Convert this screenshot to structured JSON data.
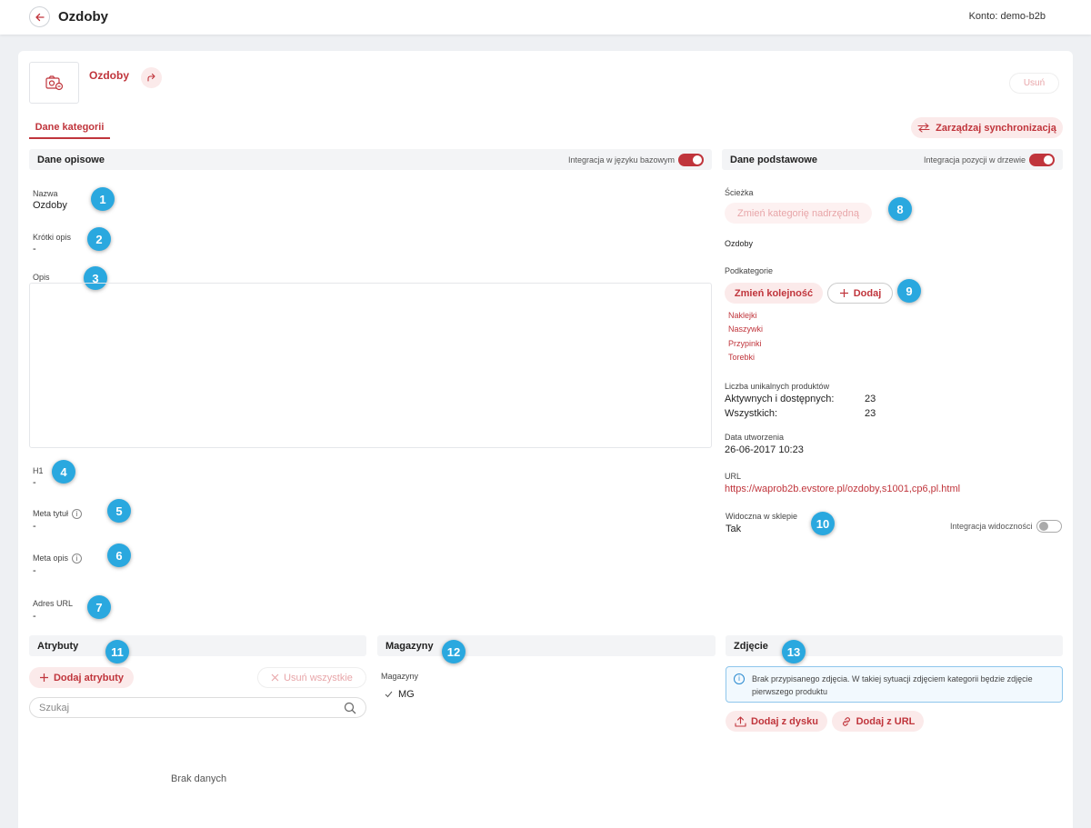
{
  "topbar": {
    "title": "Ozdoby",
    "account_label": "Konto:",
    "account_value": "demo-b2b"
  },
  "header": {
    "category_name": "Ozdoby",
    "delete_label": "Usuń",
    "tab_label": "Dane kategorii",
    "sync_label": "Zarządzaj synchronizacją"
  },
  "descriptive": {
    "title": "Dane opisowe",
    "integration_label": "Integracja w języku bazowym",
    "integration_on": true,
    "name_label": "Nazwa",
    "name_value": "Ozdoby",
    "short_label": "Krótki opis",
    "short_value": "-",
    "desc_label": "Opis",
    "h1_label": "H1",
    "h1_value": "-",
    "meta_title_label": "Meta tytuł",
    "meta_title_value": "-",
    "meta_desc_label": "Meta opis",
    "meta_desc_value": "-",
    "url_label": "Adres URL",
    "url_value": "-"
  },
  "basic": {
    "title": "Dane podstawowe",
    "integration_label": "Integracja pozycji w drzewie",
    "integration_on": true,
    "path_label": "Ścieżka",
    "change_parent": "Zmień kategorię nadrzędną",
    "path_value": "Ozdoby",
    "sub_label": "Podkategorie",
    "change_order": "Zmień kolejność",
    "add": "Dodaj",
    "subcategories": [
      "Naklejki",
      "Naszywki",
      "Przypinki",
      "Torebki"
    ],
    "count_label": "Liczba unikalnych produktów",
    "active_label": "Aktywnych i dostępnych:",
    "active_value": "23",
    "all_label": "Wszystkich:",
    "all_value": "23",
    "created_label": "Data utworzenia",
    "created_value": "26-06-2017 10:23",
    "url_label": "URL",
    "url_value": "https://waprob2b.evstore.pl/ozdoby,s1001,cp6,pl.html",
    "visible_label": "Widoczna w sklepie",
    "visible_value": "Tak",
    "visibility_integration_label": "Integracja widoczności",
    "visibility_integration_on": false
  },
  "attributes": {
    "title": "Atrybuty",
    "add": "Dodaj atrybuty",
    "remove_all": "Usuń wszystkie",
    "search_placeholder": "Szukaj",
    "empty": "Brak danych"
  },
  "warehouses": {
    "title": "Magazyny",
    "label": "Magazyny",
    "items": [
      "MG"
    ]
  },
  "photo": {
    "title": "Zdjęcie",
    "info": "Brak przypisanego zdjęcia. W takiej sytuacji zdjęciem kategorii będzie zdjęcie pierwszego produktu",
    "add_disk": "Dodaj z dysku",
    "add_url": "Dodaj z URL"
  },
  "badges": [
    "1",
    "2",
    "3",
    "4",
    "5",
    "6",
    "7",
    "8",
    "9",
    "10",
    "11",
    "12",
    "13"
  ],
  "colors": {
    "accent": "#c0353c",
    "badge": "#2aa8df",
    "info_border": "#8ec6ec"
  },
  "icons": [
    "back-arrow-icon",
    "category-image-icon",
    "share-icon",
    "sync-icon",
    "info-icon",
    "plus-icon",
    "close-icon",
    "search-icon",
    "check-icon",
    "upload-icon",
    "link-icon"
  ]
}
